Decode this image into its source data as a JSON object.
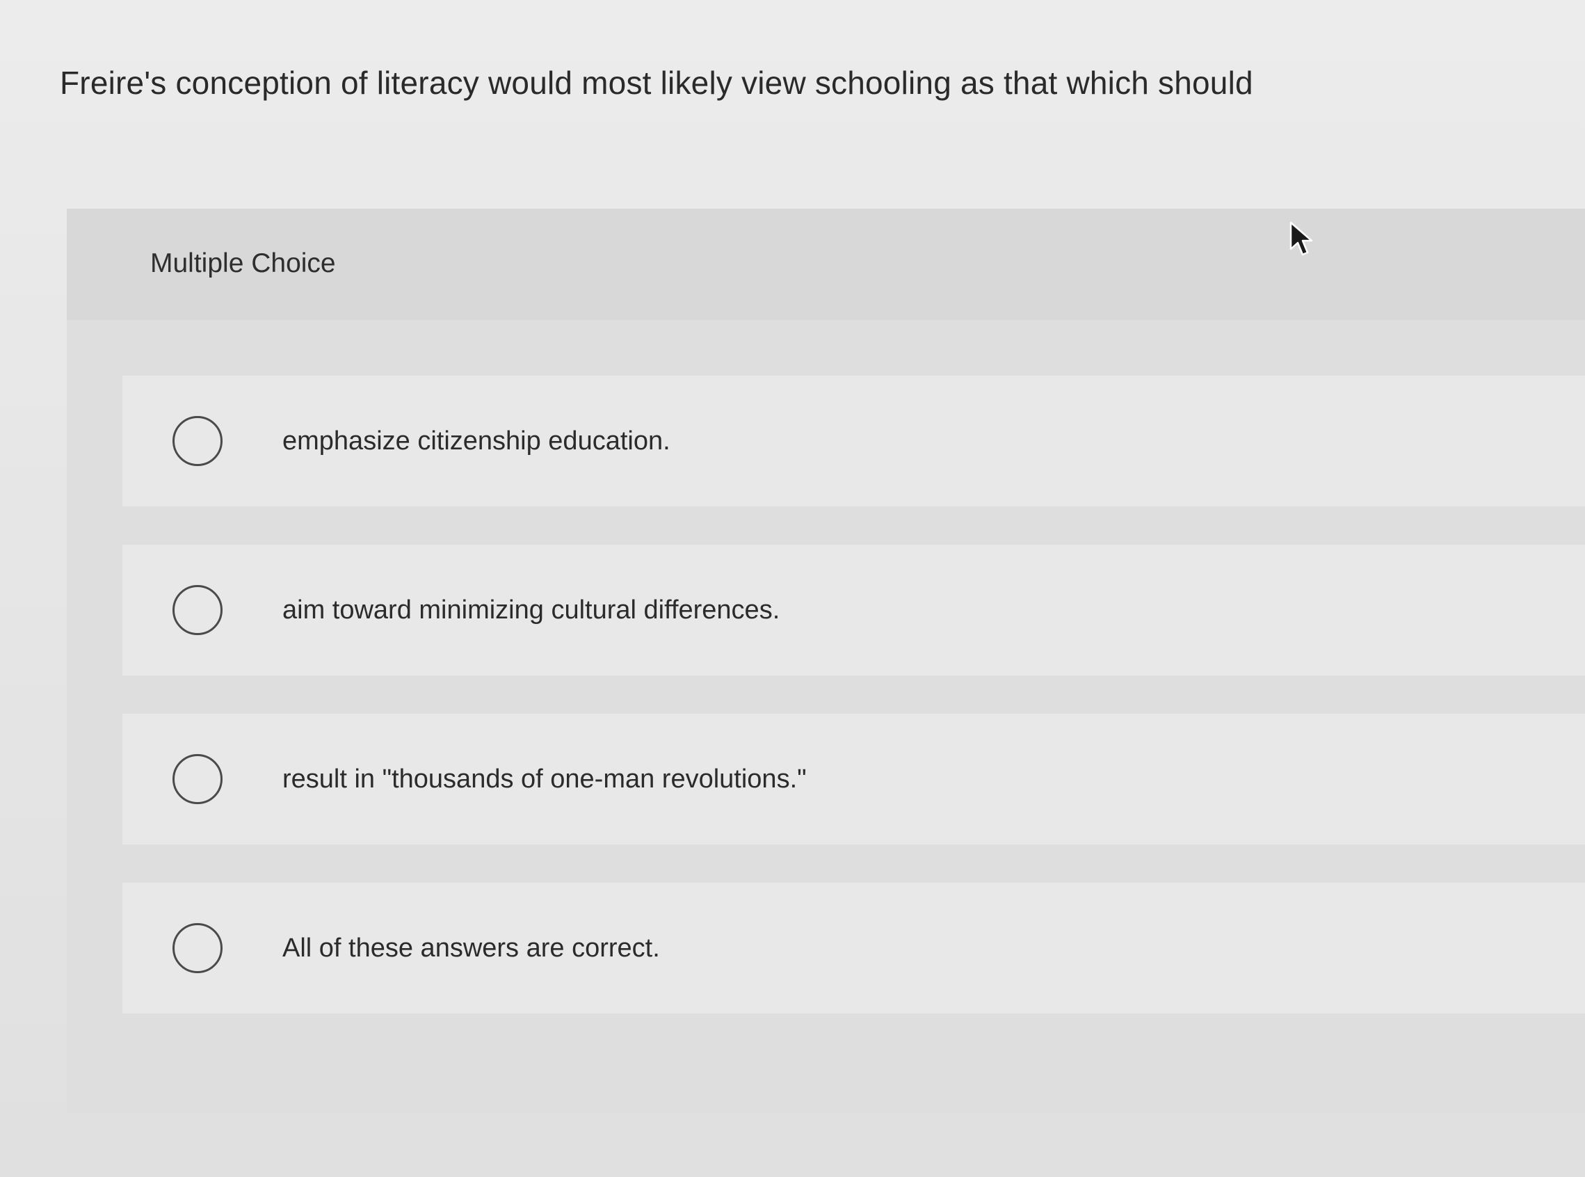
{
  "question": {
    "text": "Freire's conception of literacy would most likely view schooling as that which should"
  },
  "question_type": {
    "label": "Multiple Choice"
  },
  "options": [
    {
      "label": "emphasize citizenship education.",
      "selected": false
    },
    {
      "label": "aim toward minimizing cultural differences.",
      "selected": false
    },
    {
      "label": "result in \"thousands of one-man revolutions.\"",
      "selected": false
    },
    {
      "label": "All of these answers are correct.",
      "selected": false
    }
  ],
  "icons": {
    "radio": "radio-button-icon",
    "cursor": "mouse-pointer-icon"
  },
  "colors": {
    "background": "#e6e6e6",
    "card": "#dedede",
    "option_row": "#e8e8e8",
    "text": "#2b2b2b",
    "radio_border": "#4a4a4a"
  }
}
